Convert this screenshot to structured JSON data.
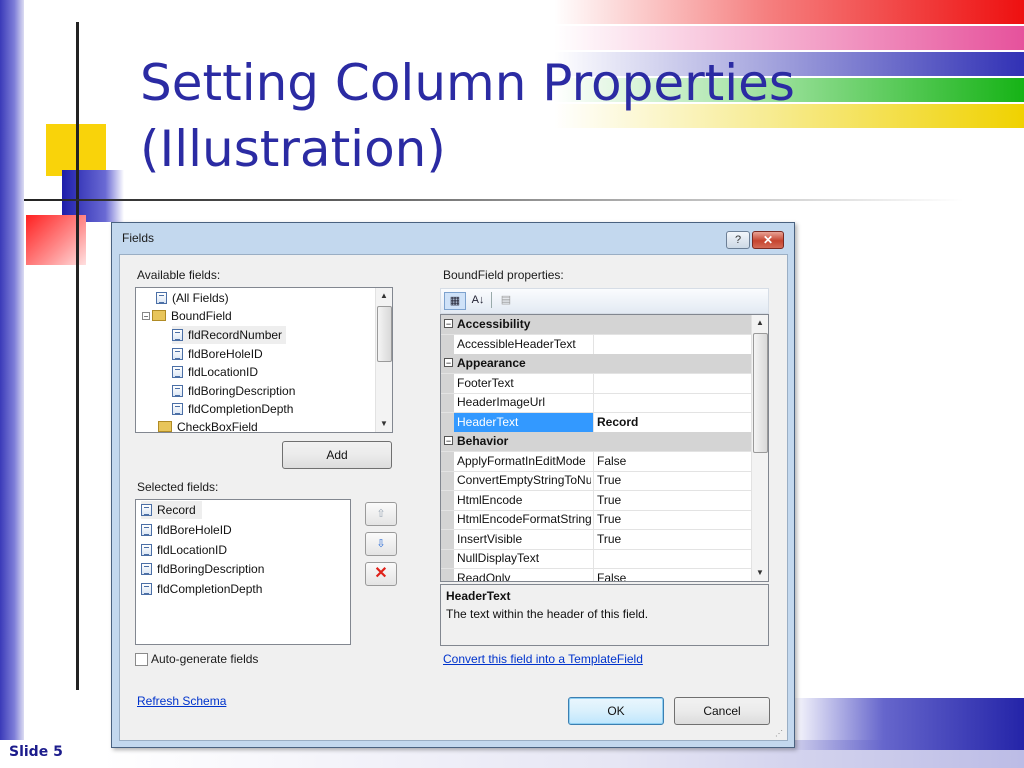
{
  "slide": {
    "title_line1": "Setting Column Properties",
    "title_line2": "(Illustration)",
    "footer": "Slide 5"
  },
  "dialog": {
    "title": "Fields",
    "help_label": "?",
    "close_label": "✕",
    "available_fields_label": "Available fields:",
    "available_fields": [
      "(All Fields)",
      "BoundField",
      "fldRecordNumber",
      "fldBoreHoleID",
      "fldLocationID",
      "fldBoringDescription",
      "fldCompletionDepth",
      "CheckBoxField"
    ],
    "add_label": "Add",
    "selected_fields_label": "Selected fields:",
    "selected_fields": [
      "Record",
      "fldBoreHoleID",
      "fldLocationID",
      "fldBoringDescription",
      "fldCompletionDepth"
    ],
    "move_up_icon": "arrow-up-icon",
    "move_down_icon": "arrow-down-icon",
    "delete_icon": "delete-x-icon",
    "auto_generate_label": "Auto-generate fields",
    "refresh_schema_label": "Refresh Schema",
    "properties_label": "BoundField properties:",
    "properties": [
      {
        "category": "Accessibility",
        "items": [
          {
            "name": "AccessibleHeaderText",
            "value": ""
          }
        ]
      },
      {
        "category": "Appearance",
        "items": [
          {
            "name": "FooterText",
            "value": ""
          },
          {
            "name": "HeaderImageUrl",
            "value": ""
          },
          {
            "name": "HeaderText",
            "value": "Record"
          }
        ]
      },
      {
        "category": "Behavior",
        "items": [
          {
            "name": "ApplyFormatInEditMode",
            "value": "False"
          },
          {
            "name": "ConvertEmptyStringToNull",
            "value": "True"
          },
          {
            "name": "HtmlEncode",
            "value": "True"
          },
          {
            "name": "HtmlEncodeFormatString",
            "value": "True"
          },
          {
            "name": "InsertVisible",
            "value": "True"
          },
          {
            "name": "NullDisplayText",
            "value": ""
          },
          {
            "name": "ReadOnly",
            "value": "False"
          }
        ]
      }
    ],
    "selected_property": "HeaderText",
    "description_title": "HeaderText",
    "description_text": "The text within the header of this field.",
    "convert_link": "Convert this field into a TemplateField",
    "ok_label": "OK",
    "cancel_label": "Cancel",
    "colors": {
      "title": "#2b2ba3",
      "selection": "#3399ff",
      "link": "#0033cc"
    }
  }
}
